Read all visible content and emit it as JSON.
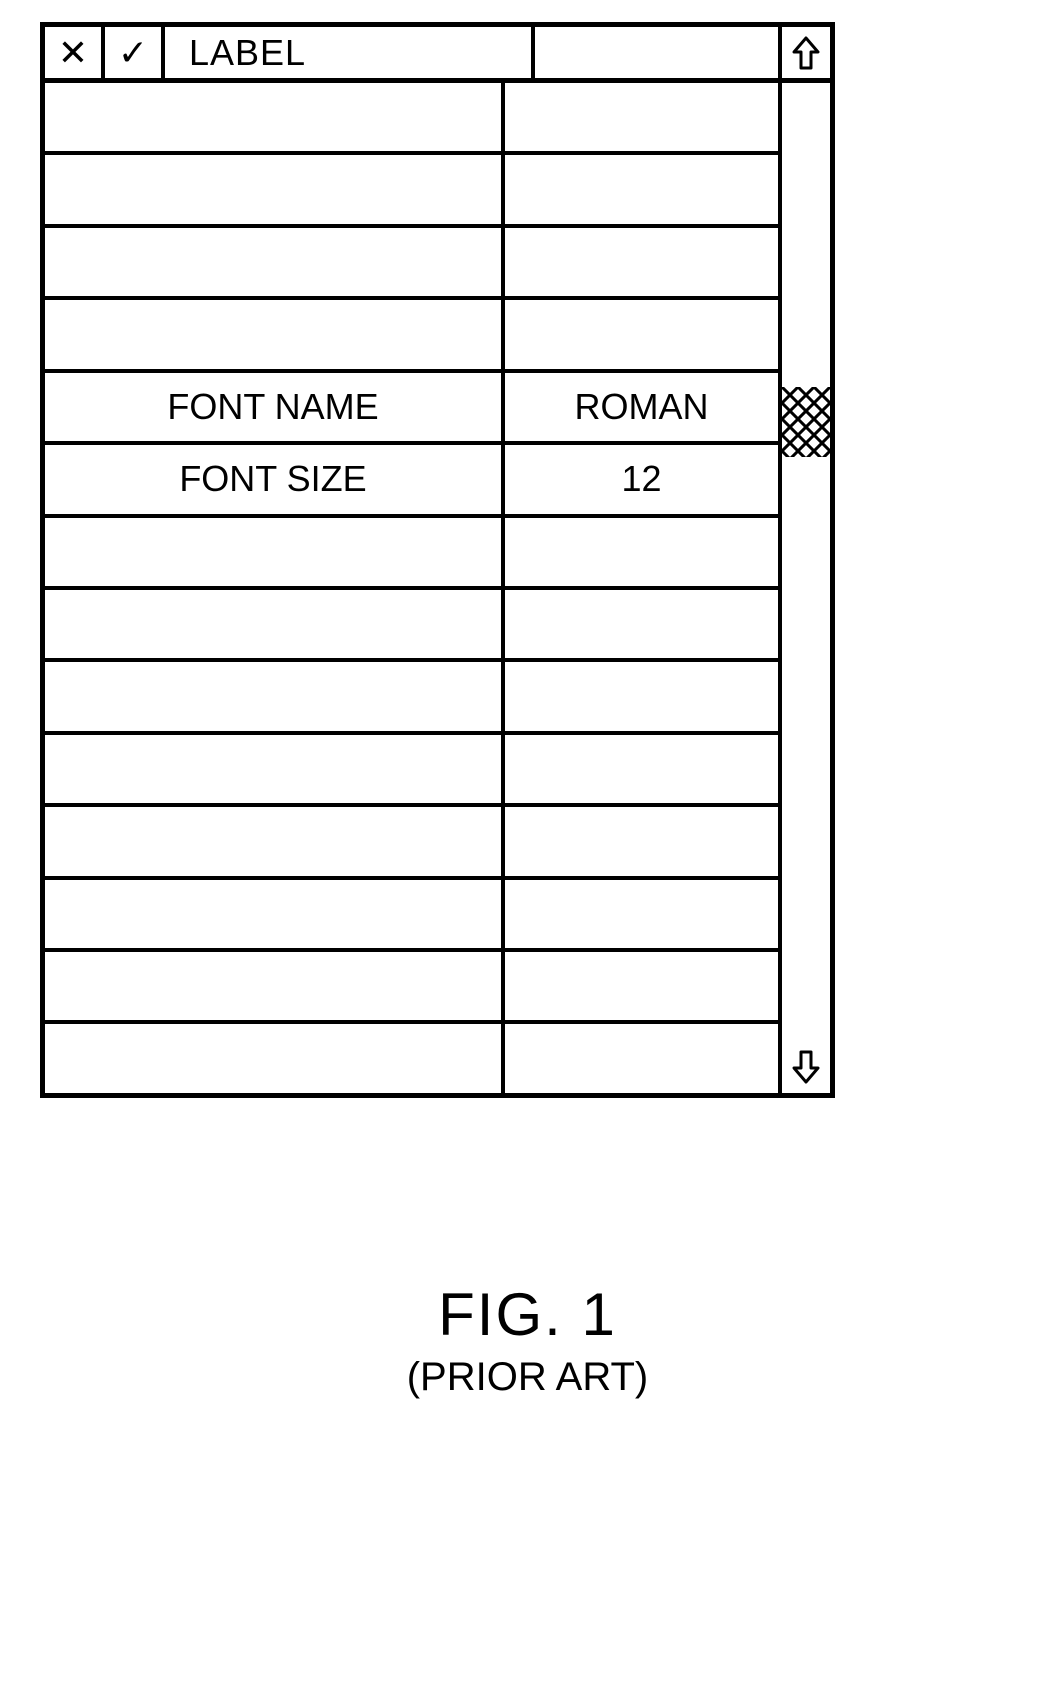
{
  "header": {
    "cancel_glyph": "✕",
    "confirm_glyph": "✓",
    "label": "LABEL",
    "value": ""
  },
  "rows": [
    {
      "label": "",
      "value": ""
    },
    {
      "label": "",
      "value": ""
    },
    {
      "label": "",
      "value": ""
    },
    {
      "label": "",
      "value": ""
    },
    {
      "label": "FONT NAME",
      "value": "ROMAN"
    },
    {
      "label": "FONT SIZE",
      "value": "12"
    },
    {
      "label": "",
      "value": ""
    },
    {
      "label": "",
      "value": ""
    },
    {
      "label": "",
      "value": ""
    },
    {
      "label": "",
      "value": ""
    },
    {
      "label": "",
      "value": ""
    },
    {
      "label": "",
      "value": ""
    },
    {
      "label": "",
      "value": ""
    },
    {
      "label": "",
      "value": ""
    }
  ],
  "caption": {
    "line1": "FIG. 1",
    "line2": "(PRIOR ART)"
  }
}
